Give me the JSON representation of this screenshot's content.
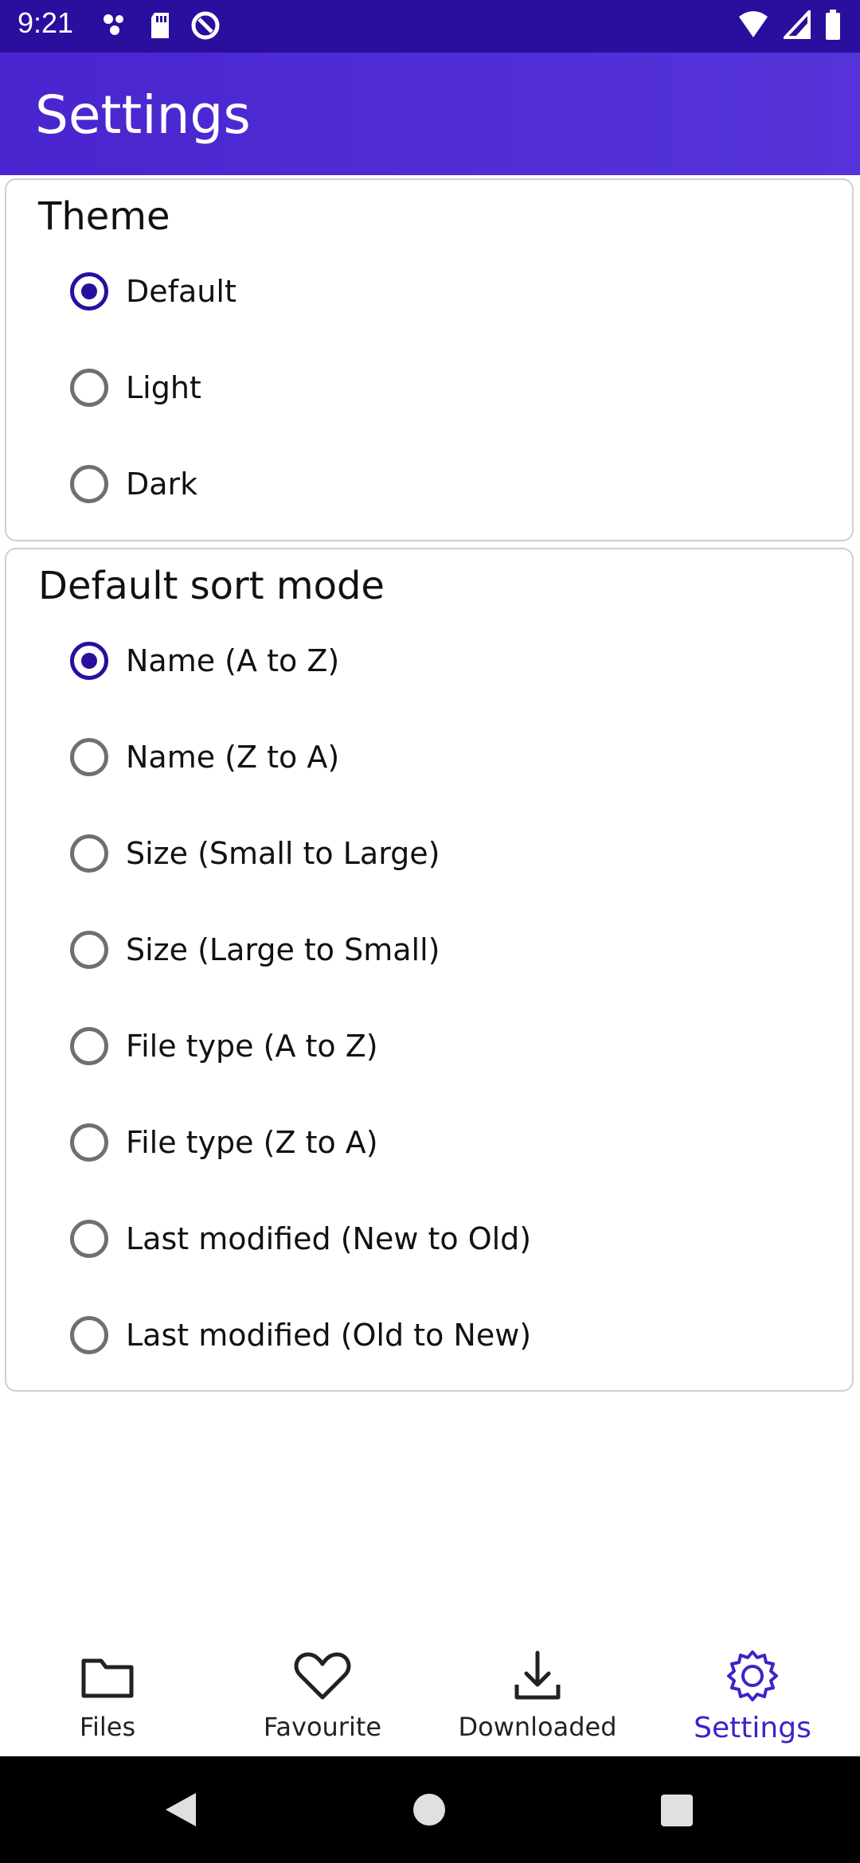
{
  "status_bar": {
    "time": "9:21",
    "left_icons": [
      "notification-dots-icon",
      "sd-card-icon",
      "data-saver-icon"
    ],
    "right_icons": [
      "wifi-icon",
      "cell-signal-icon",
      "battery-icon"
    ]
  },
  "app_bar": {
    "title": "Settings"
  },
  "theme": {
    "title": "Theme",
    "selected": "Default",
    "options": [
      "Default",
      "Light",
      "Dark"
    ]
  },
  "sort": {
    "title": "Default sort mode",
    "selected": "Name (A to Z)",
    "options": [
      "Name (A to Z)",
      "Name (Z to A)",
      "Size (Small to Large)",
      "Size (Large to Small)",
      "File type (A to Z)",
      "File type (Z to A)",
      "Last modified (New to Old)",
      "Last modified (Old to New)"
    ]
  },
  "bottom_nav": {
    "items": [
      {
        "label": "Files",
        "icon": "folder-icon"
      },
      {
        "label": "Favourite",
        "icon": "heart-icon"
      },
      {
        "label": "Downloaded",
        "icon": "download-icon"
      },
      {
        "label": "Settings",
        "icon": "gear-icon"
      }
    ],
    "active": "Settings"
  },
  "system_nav": {
    "buttons": [
      "back-icon",
      "home-icon",
      "recents-icon"
    ]
  },
  "colors": {
    "status_bar": "#2a0e9e",
    "app_bar": "#4a25cf",
    "accent": "#2a0e9e",
    "active_nav": "#3f22c9"
  }
}
